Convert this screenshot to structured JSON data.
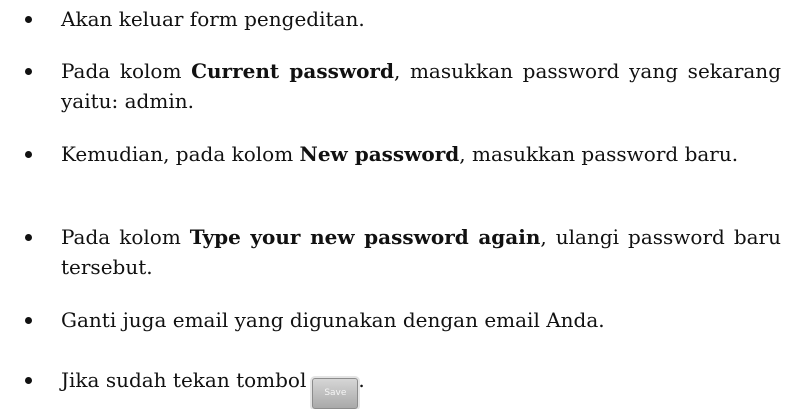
{
  "items": [
    {
      "text": "Akan keluar form pengeditan."
    },
    {
      "before": "Pada kolom ",
      "bold": "Current password",
      "after": ", masukkan password yang sekarang yaitu: admin."
    },
    {
      "before": "Kemudian, pada kolom ",
      "bold": "New password",
      "after": ", masukkan password baru."
    },
    {
      "before": "Pada kolom ",
      "bold": "Type your new password again",
      "after": ", ulangi password baru tersebut."
    },
    {
      "text": "Ganti juga email yang digunakan dengan email Anda."
    },
    {
      "before": "Jika sudah tekan tombol",
      "after": "."
    }
  ],
  "save_button": {
    "label": "Save"
  }
}
